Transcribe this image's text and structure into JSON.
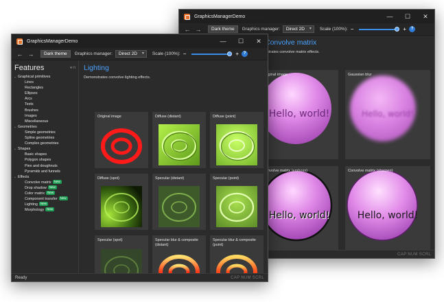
{
  "app_title": "GraphicsManagerDemo",
  "window_controls": {
    "minimize": "—",
    "maximize": "☐",
    "close": "✕"
  },
  "toolbar": {
    "back": "←",
    "forward": "→",
    "theme_button": "Dark theme",
    "graphics_label": "Graphics manager:",
    "graphics_value": "Direct 2D",
    "scale_label": "Scale (100%):",
    "zoom_minus": "−",
    "zoom_plus": "+",
    "help": "?",
    "scale_level": 1.0
  },
  "status": {
    "text": "Ready",
    "keys": "CAP  NUM  SCRL"
  },
  "sidebar": {
    "title": "Features",
    "pin": "▾ ⊓",
    "tree": [
      {
        "type": "group",
        "label": "Graphical primitives"
      },
      {
        "type": "item",
        "label": "Lines"
      },
      {
        "type": "item",
        "label": "Rectangles"
      },
      {
        "type": "item",
        "label": "Ellipses"
      },
      {
        "type": "item",
        "label": "Arcs"
      },
      {
        "type": "item",
        "label": "Texts"
      },
      {
        "type": "item",
        "label": "Brushes"
      },
      {
        "type": "item",
        "label": "Images"
      },
      {
        "type": "item",
        "label": "Miscellaneous"
      },
      {
        "type": "group",
        "label": "Geometries"
      },
      {
        "type": "item",
        "label": "Simple geometries"
      },
      {
        "type": "item",
        "label": "Spline geometries"
      },
      {
        "type": "item",
        "label": "Complex geometries"
      },
      {
        "type": "group",
        "label": "Shapes"
      },
      {
        "type": "item",
        "label": "Basic shapes"
      },
      {
        "type": "item",
        "label": "Polygon shapes"
      },
      {
        "type": "item",
        "label": "Pies and doughnuts"
      },
      {
        "type": "item",
        "label": "Pyramids and funnels"
      },
      {
        "type": "group",
        "label": "Effects"
      },
      {
        "type": "item",
        "label": "Convolve matrix",
        "badge": "New"
      },
      {
        "type": "item",
        "label": "Drop shadow",
        "badge": "New"
      },
      {
        "type": "item",
        "label": "Color matrix",
        "badge": "New"
      },
      {
        "type": "item",
        "label": "Component transfer",
        "badge": "New"
      },
      {
        "type": "item",
        "label": "Lighting",
        "badge": "New"
      },
      {
        "type": "item",
        "label": "Morphology",
        "badge": "New"
      }
    ]
  },
  "front_page": {
    "title": "Lighting",
    "description": "Demonstrates convolve lighting effects.",
    "cards": [
      {
        "label": "Original image"
      },
      {
        "label": "Diffuse (distant)"
      },
      {
        "label": "Diffuse (point)"
      },
      {
        "label": "Diffuse (spot)"
      },
      {
        "label": "Specular (distant)"
      },
      {
        "label": "Specular (point)"
      },
      {
        "label": "Specular (spot)"
      },
      {
        "label": "Specular blur & composite (distant)"
      },
      {
        "label": "Specular blur & composite (point)"
      }
    ]
  },
  "back_page": {
    "title": "Convolve matrix",
    "description": "Demonstrates convolve matrix effects.",
    "cards": [
      {
        "label": "Original image",
        "sample_text": "Hello, world!"
      },
      {
        "label": "Gaussian blur",
        "sample_text": "Hello, world!"
      },
      {
        "label": "Convolve matrix (emboss)",
        "sample_text": "Hello, world!"
      },
      {
        "label": "Convolve matrix (sharpen)",
        "sample_text": "Hello, world!"
      }
    ]
  },
  "colors": {
    "accent_title": "#4aa3ff",
    "badge_new": "#1f9d55",
    "sphere": "#d36fe0",
    "ring_red": "#ff1a1a",
    "lit_green": "#8fd12f"
  }
}
